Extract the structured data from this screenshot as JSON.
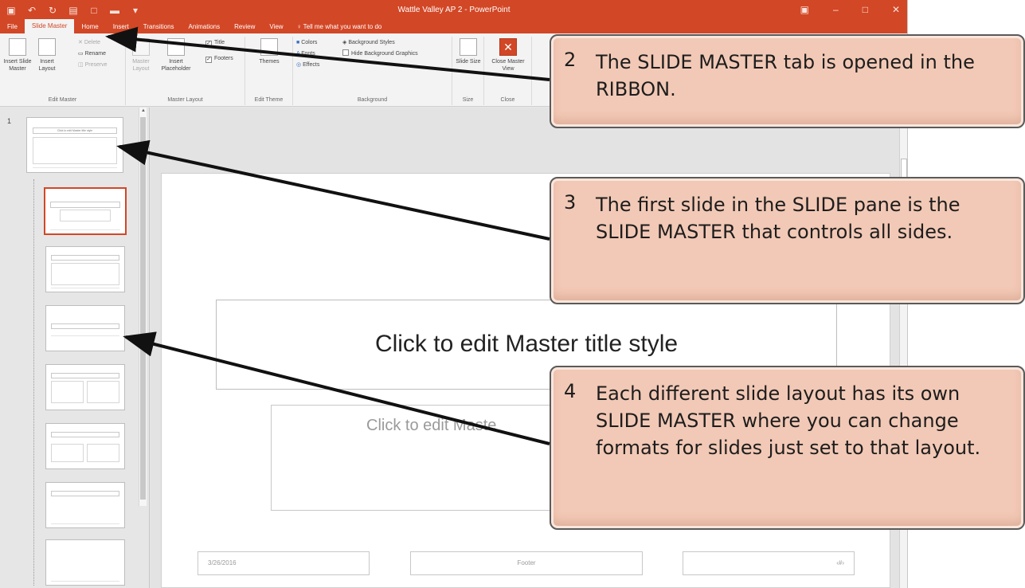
{
  "window": {
    "title": "Wattle Valley AP 2 - PowerPoint"
  },
  "tabs": [
    "File",
    "Slide Master",
    "Home",
    "Insert",
    "Transitions",
    "Animations",
    "Review",
    "View"
  ],
  "tell_me": "Tell me what you want to do",
  "ribbon": {
    "edit_master": {
      "label": "Edit Master",
      "insert_slide_master": "Insert Slide Master",
      "insert_layout": "Insert Layout",
      "delete": "Delete",
      "rename": "Rename",
      "preserve": "Preserve"
    },
    "master_layout": {
      "label": "Master Layout",
      "master_layout_btn": "Master Layout",
      "insert_placeholder": "Insert Placeholder",
      "title": "Title",
      "footers": "Footers"
    },
    "edit_theme": {
      "label": "Edit Theme",
      "themes": "Themes"
    },
    "background": {
      "label": "Background",
      "colors": "Colors",
      "fonts": "Fonts",
      "effects": "Effects",
      "background_styles": "Background Styles",
      "hide_background_graphics": "Hide Background Graphics"
    },
    "size": {
      "label": "Size",
      "slide_size": "Slide Size"
    },
    "close": {
      "label": "Close",
      "close_master_view": "Close Master View"
    }
  },
  "thumbnails": {
    "first_number": "1",
    "master_title": "Click to edit Master title style"
  },
  "slide": {
    "title": "Click to edit Master title style",
    "body": "Click to edit Maste",
    "date": "3/26/2016",
    "footer": "Footer",
    "page_number": "‹#›"
  },
  "callouts": [
    {
      "number": "2",
      "text": "The SLIDE MASTER tab is opened in the RIBBON."
    },
    {
      "number": "3",
      "text": "The first slide in the SLIDE pane is the SLIDE MASTER that controls all sides."
    },
    {
      "number": "4",
      "text": "Each different slide layout has its own SLIDE MASTER where you can change formats for slides just set to that layout."
    }
  ],
  "colors": {
    "accent": "#d24726",
    "callout_fill": "#f2c9b6"
  }
}
